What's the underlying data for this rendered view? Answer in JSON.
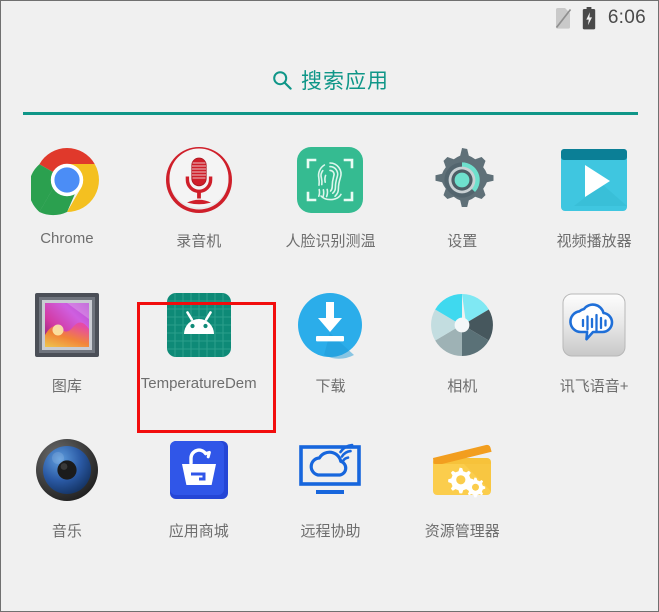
{
  "status_bar": {
    "time": "6:06",
    "icons": [
      {
        "name": "no-sim-icon",
        "label": "no SIM card"
      },
      {
        "name": "battery-charging-icon",
        "label": "battery charging"
      }
    ]
  },
  "search": {
    "icon": "search-icon",
    "label": "搜索应用",
    "accent_color": "#0f9688"
  },
  "highlight": {
    "color": "#f20d0d",
    "target_app": "TemperatureDem"
  },
  "colors": {
    "background": "#f0f0f0",
    "label_text": "#6e6e6e",
    "accent": "#0f9688",
    "highlight": "#f20d0d"
  },
  "app_grid": {
    "rows": [
      {
        "apps": [
          {
            "label": "Chrome",
            "icon": "chrome-icon"
          },
          {
            "label": "录音机",
            "icon": "voice-recorder-icon"
          },
          {
            "label": "人脸识别测温",
            "icon": "face-recognition-temperature-icon"
          },
          {
            "label": "设置",
            "icon": "settings-gear-icon"
          },
          {
            "label": "视频播放器",
            "icon": "video-player-icon"
          }
        ]
      },
      {
        "apps": [
          {
            "label": "图库",
            "icon": "gallery-icon"
          },
          {
            "label": "TemperatureDem",
            "icon": "android-robot-icon"
          },
          {
            "label": "下载",
            "icon": "download-icon"
          },
          {
            "label": "相机",
            "icon": "camera-shutter-icon"
          },
          {
            "label": "讯飞语音+",
            "icon": "iflytek-voice-icon"
          }
        ]
      },
      {
        "apps": [
          {
            "label": "音乐",
            "icon": "music-speaker-icon"
          },
          {
            "label": "应用商城",
            "icon": "app-store-basket-icon"
          },
          {
            "label": "远程协助",
            "icon": "remote-assistance-icon"
          },
          {
            "label": "资源管理器",
            "icon": "file-manager-icon"
          }
        ]
      }
    ]
  }
}
